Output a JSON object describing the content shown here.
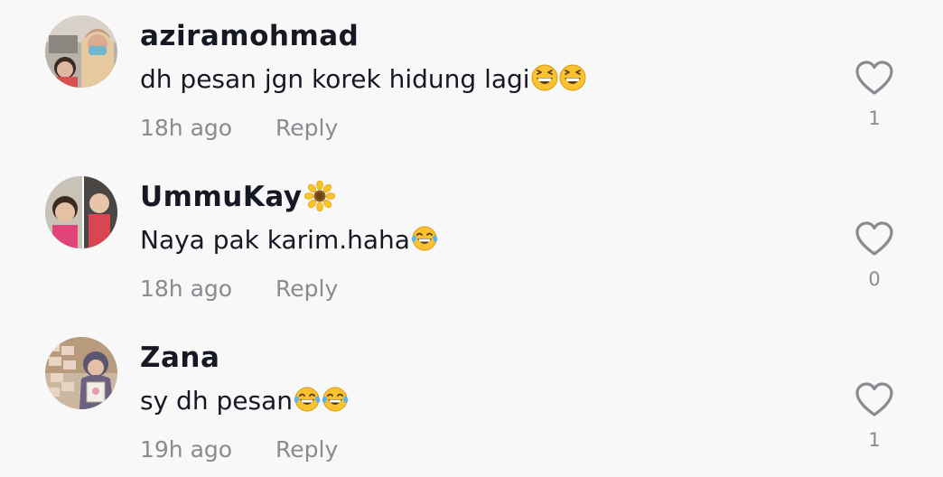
{
  "comments": [
    {
      "username": "aziramohmad",
      "text": "dh pesan jgn korek hidung lagi",
      "text_emoji": [
        "grinning-squinting-face-icon",
        "grinning-squinting-face-icon"
      ],
      "timestamp": "18h ago",
      "reply_label": "Reply",
      "like_count": "1"
    },
    {
      "username": "UmmuKay",
      "username_emoji": "sunflower-icon",
      "text": "Naya pak karim.haha",
      "text_emoji": [
        "face-with-tears-of-joy-icon"
      ],
      "timestamp": "18h ago",
      "reply_label": "Reply",
      "like_count": "0"
    },
    {
      "username": "Zana",
      "text": "sy dh pesan",
      "text_emoji": [
        "face-with-tears-of-joy-icon",
        "face-with-tears-of-joy-icon"
      ],
      "timestamp": "19h ago",
      "reply_label": "Reply",
      "like_count": "1"
    }
  ],
  "colors": {
    "background": "#f8f8f8",
    "primary_text": "#161823",
    "secondary_text": "#8a8b91",
    "heart_outline": "#8a8b91"
  }
}
